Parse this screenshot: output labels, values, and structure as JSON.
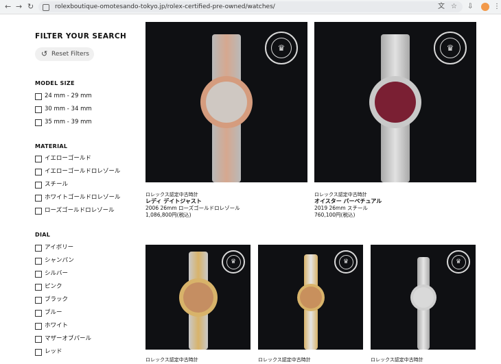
{
  "browser": {
    "url": "rolexboutique-omotesando-tokyo.jp/rolex-certified-pre-owned/watches/"
  },
  "sidebar": {
    "title": "FILTER YOUR SEARCH",
    "reset": "Reset Filters",
    "model_size": {
      "title": "MODEL SIZE",
      "options": [
        "24 mm - 29 mm",
        "30 mm - 34 mm",
        "35 mm - 39 mm"
      ]
    },
    "material": {
      "title": "MATERIAL",
      "options": [
        "イエローゴールド",
        "イエローゴールドロレゾール",
        "スチール",
        "ホワイトゴールドロレゾール",
        "ローズゴールドロレゾール"
      ]
    },
    "dial": {
      "title": "DIAL",
      "options": [
        "アイボリー",
        "シャンパン",
        "シルバー",
        "ピンク",
        "ブラック",
        "ブルー",
        "ホワイト",
        "マザーオブパール",
        "レッド"
      ]
    }
  },
  "products": [
    {
      "kicker": "ロレックス認定中古時計",
      "name": "レディ デイトジャスト",
      "detail": "2006 26mm ローズゴールドロレゾール",
      "price": "1,086,800円(税込)"
    },
    {
      "kicker": "ロレックス認定中古時計",
      "name": "オイスター パーペチュアル",
      "detail": "2019 26mm スチール",
      "price": "760,100円(税込)"
    },
    {
      "kicker": "ロレックス認定中古時計"
    },
    {
      "kicker": "ロレックス認定中古時計"
    },
    {
      "kicker": "ロレックス認定中古時計"
    }
  ],
  "colors": {
    "card_bg": "#0f1013",
    "rose": "#d59c7e",
    "steel": "#c9c9c9",
    "gold": "#d8b36a",
    "red_dial": "#7a1f33"
  }
}
